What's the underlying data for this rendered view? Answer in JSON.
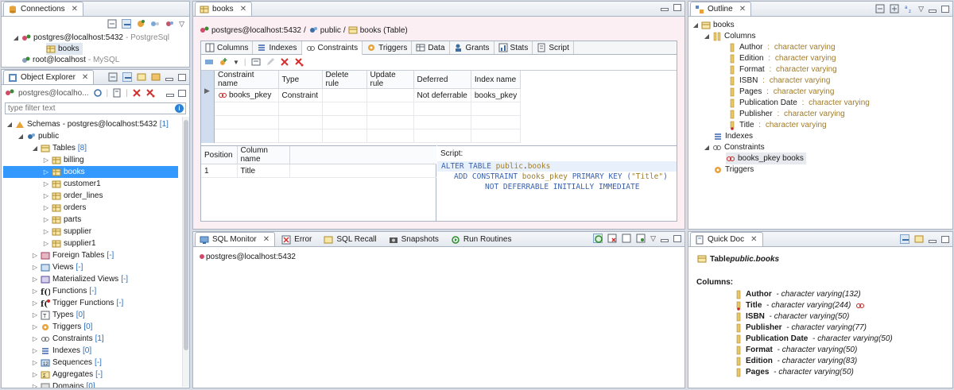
{
  "connections": {
    "tab_label": "Connections",
    "items": [
      {
        "name": "postgres@localhost:5432",
        "suffix": " - PostgreSql"
      },
      {
        "name": "books"
      },
      {
        "name": "root@localhost",
        "suffix": " - MySQL"
      }
    ]
  },
  "object_explorer": {
    "tab_label": "Object Explorer",
    "connection": "postgres@localho...",
    "filter_placeholder": "type filter text",
    "tree": [
      {
        "label": "Schemas",
        "extra": " - postgres@localhost:5432",
        "count": "[1]"
      },
      {
        "label": "public"
      },
      {
        "label": "Tables",
        "count": "[8]"
      },
      {
        "label": "billing"
      },
      {
        "label": "books"
      },
      {
        "label": "customer1"
      },
      {
        "label": "order_lines"
      },
      {
        "label": "orders"
      },
      {
        "label": "parts"
      },
      {
        "label": "supplier"
      },
      {
        "label": "supplier1"
      },
      {
        "label": "Foreign Tables",
        "count": "[-]"
      },
      {
        "label": "Views",
        "count": "[-]"
      },
      {
        "label": "Materialized Views",
        "count": "[-]"
      },
      {
        "label": "Functions",
        "count": "[-]"
      },
      {
        "label": "Trigger Functions",
        "count": "[-]"
      },
      {
        "label": "Types",
        "count": "[0]"
      },
      {
        "label": "Triggers",
        "count": "[0]"
      },
      {
        "label": "Constraints",
        "count": "[1]"
      },
      {
        "label": "Indexes",
        "count": "[0]"
      },
      {
        "label": "Sequences",
        "count": "[-]"
      },
      {
        "label": "Aggregates",
        "count": "[-]"
      },
      {
        "label": "Domains",
        "count": "[0]"
      }
    ]
  },
  "editor": {
    "tab_label": "books",
    "breadcrumb": {
      "conn": "postgres@localhost:5432",
      "sep": "/",
      "schema": "public",
      "table": "books (Table)"
    },
    "subtabs": [
      "Columns",
      "Indexes",
      "Constraints",
      "Triggers",
      "Data",
      "Grants",
      "Stats",
      "Script"
    ],
    "constraints_table": {
      "headers": [
        "Constraint name",
        "Type",
        "Delete rule",
        "Update rule",
        "Deferred",
        "Index name"
      ],
      "rows": [
        [
          "books_pkey",
          "Constraint",
          "",
          "",
          "Not deferrable",
          "books_pkey"
        ]
      ]
    },
    "columns_table": {
      "headers": [
        "Position",
        "Column name"
      ],
      "rows": [
        [
          "1",
          "Title"
        ]
      ]
    },
    "script_label": "Script:",
    "script": {
      "l1_kw": "ALTER TABLE ",
      "l1_obj": "public",
      "l1_dot": ".",
      "l1_tbl": "books",
      "l2_kw": "ADD CONSTRAINT ",
      "l2_name": "books_pkey",
      "l2_kw2": " PRIMARY KEY (",
      "l2_str": "\"Title\"",
      "l2_end": ")",
      "l3": "NOT DEFERRABLE INITIALLY IMMEDIATE"
    }
  },
  "bottom_tabs": {
    "items": [
      "SQL Monitor",
      "Error",
      "SQL Recall",
      "Snapshots",
      "Run Routines"
    ],
    "monitor_connection": "postgres@localhost:5432"
  },
  "outline": {
    "tab_label": "Outline",
    "root": "books",
    "columns_label": "Columns",
    "columns": [
      {
        "name": "Author",
        "type": "character varying"
      },
      {
        "name": "Edition",
        "type": "character varying"
      },
      {
        "name": "Format",
        "type": "character varying"
      },
      {
        "name": "ISBN",
        "type": "character varying"
      },
      {
        "name": "Pages",
        "type": "character varying"
      },
      {
        "name": "Publication Date",
        "type": "character varying"
      },
      {
        "name": "Publisher",
        "type": "character varying"
      },
      {
        "name": "Title",
        "type": "character varying"
      }
    ],
    "indexes_label": "Indexes",
    "constraints_label": "Constraints",
    "constraint_item": "books_pkey books",
    "triggers_label": "Triggers",
    "sep": " : "
  },
  "quick_doc": {
    "tab_label": "Quick Doc",
    "table_prefix": "Table ",
    "table_name": "public.books",
    "columns_label": "Columns:",
    "dash": " - ",
    "columns": [
      {
        "name": "Author",
        "type": "character varying(132)"
      },
      {
        "name": "Title",
        "type": "character varying(244)"
      },
      {
        "name": "ISBN",
        "type": "character varying(50)"
      },
      {
        "name": "Publisher",
        "type": "character varying(77)"
      },
      {
        "name": "Publication Date",
        "type": "character varying(50)"
      },
      {
        "name": "Format",
        "type": "character varying(50)"
      },
      {
        "name": "Edition",
        "type": "character varying(83)"
      },
      {
        "name": "Pages",
        "type": "character varying(50)"
      }
    ]
  },
  "colors": {
    "accent": "#3399ff",
    "link_blue": "#2a6fc1",
    "type_gold": "#a07c2a",
    "editor_bg": "#fbeff3"
  }
}
